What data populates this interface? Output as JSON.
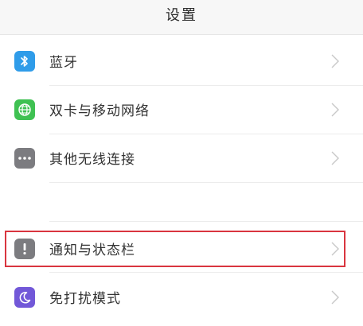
{
  "header": {
    "title": "设置"
  },
  "rows": [
    {
      "label": "蓝牙",
      "icon": "bluetooth-icon",
      "color": "#2f9ce9"
    },
    {
      "label": "双卡与移动网络",
      "icon": "globe-icon",
      "color": "#3fc152"
    },
    {
      "label": "其他无线连接",
      "icon": "more-dots-icon",
      "color": "#7c7c80"
    },
    {
      "label": "通知与状态栏",
      "icon": "exclamation-icon",
      "color": "#7c7c80"
    },
    {
      "label": "免打扰模式",
      "icon": "moon-icon",
      "color": "#7258d8"
    }
  ],
  "colors": {
    "highlight": "#d9353f",
    "chevron": "#c8c8c8",
    "divider": "#ececec"
  }
}
